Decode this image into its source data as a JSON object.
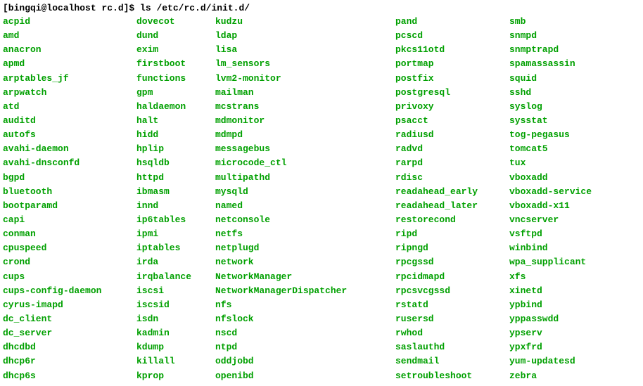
{
  "prompt": {
    "user_host": "[bingqi@localhost rc.d]$",
    "command": "ls /etc/rc.d/init.d/"
  },
  "columns": {
    "col1": [
      "acpid",
      "amd",
      "anacron",
      "apmd",
      "arptables_jf",
      "arpwatch",
      "atd",
      "auditd",
      "autofs",
      "avahi-daemon",
      "avahi-dnsconfd",
      "bgpd",
      "bluetooth",
      "bootparamd",
      "capi",
      "conman",
      "cpuspeed",
      "crond",
      "cups",
      "cups-config-daemon",
      "cyrus-imapd",
      "dc_client",
      "dc_server",
      "dhcdbd",
      "dhcp6r",
      "dhcp6s"
    ],
    "col2": [
      "dovecot",
      "dund",
      "exim",
      "firstboot",
      "functions",
      "gpm",
      "haldaemon",
      "halt",
      "hidd",
      "hplip",
      "hsqldb",
      "httpd",
      "ibmasm",
      "innd",
      "ip6tables",
      "ipmi",
      "iptables",
      "irda",
      "irqbalance",
      "iscsi",
      "iscsid",
      "isdn",
      "kadmin",
      "kdump",
      "killall",
      "kprop"
    ],
    "col3": [
      "kudzu",
      "ldap",
      "lisa",
      "lm_sensors",
      "lvm2-monitor",
      "mailman",
      "mcstrans",
      "mdmonitor",
      "mdmpd",
      "messagebus",
      "microcode_ctl",
      "multipathd",
      "mysqld",
      "named",
      "netconsole",
      "netfs",
      "netplugd",
      "network",
      "NetworkManager",
      "NetworkManagerDispatcher",
      "nfs",
      "nfslock",
      "nscd",
      "ntpd",
      "oddjobd",
      "openibd"
    ],
    "col4": [
      "pand",
      "pcscd",
      "pkcs11otd",
      "portmap",
      "postfix",
      "postgresql",
      "privoxy",
      "psacct",
      "radiusd",
      "radvd",
      "rarpd",
      "rdisc",
      "readahead_early",
      "readahead_later",
      "restorecond",
      "ripd",
      "ripngd",
      "rpcgssd",
      "rpcidmapd",
      "rpcsvcgssd",
      "rstatd",
      "rusersd",
      "rwhod",
      "saslauthd",
      "sendmail",
      "setroubleshoot"
    ],
    "col5": [
      "smb",
      "snmpd",
      "snmptrapd",
      "spamassassin",
      "squid",
      "sshd",
      "syslog",
      "sysstat",
      "tog-pegasus",
      "tomcat5",
      "tux",
      "vboxadd",
      "vboxadd-service",
      "vboxadd-x11",
      "vncserver",
      "vsftpd",
      "winbind",
      "wpa_supplicant",
      "xfs",
      "xinetd",
      "ypbind",
      "yppasswdd",
      "ypserv",
      "ypxfrd",
      "yum-updatesd",
      "zebra"
    ]
  }
}
